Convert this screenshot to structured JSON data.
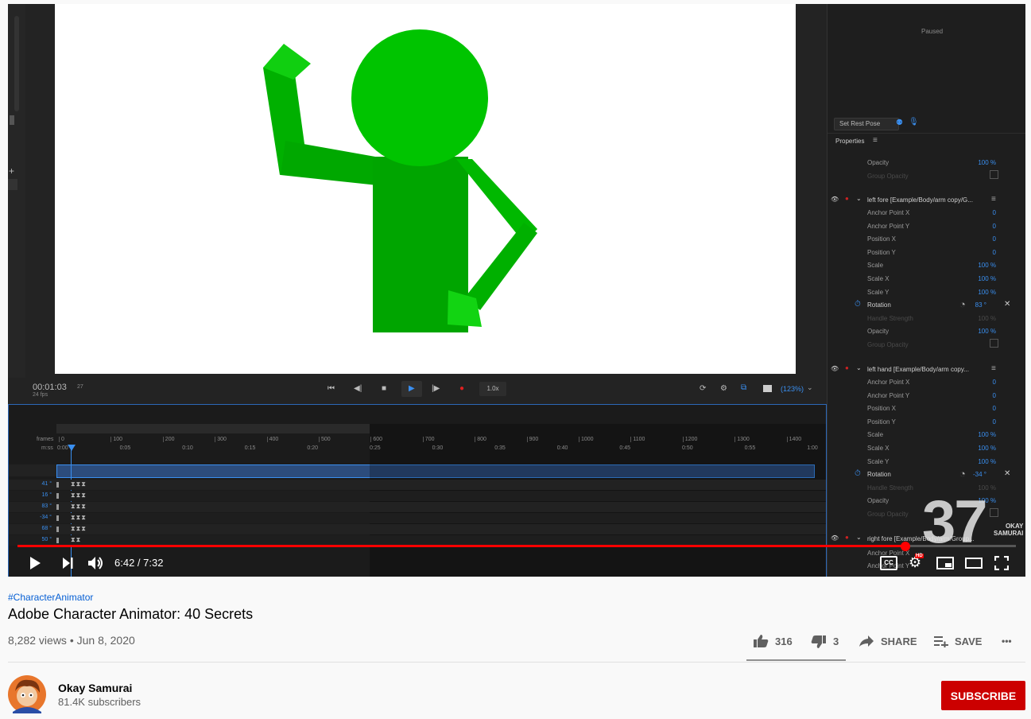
{
  "video": {
    "app_ui": {
      "status": "Paused",
      "set_rest_pose": "Set Rest Pose",
      "properties_title": "Properties",
      "timecode": "00:01:03",
      "frame": "27",
      "fps": "24 fps",
      "speed": "1.0x",
      "zoom": "(123%)",
      "props_top": [
        {
          "label": "Opacity",
          "value": "100 %"
        },
        {
          "label": "Group Opacity",
          "value": ""
        }
      ],
      "layer1": {
        "name": "left fore [Example/Body/arm copy/G...",
        "rows": [
          {
            "label": "Anchor Point X",
            "value": "0"
          },
          {
            "label": "Anchor Point Y",
            "value": "0"
          },
          {
            "label": "Position X",
            "value": "0"
          },
          {
            "label": "Position Y",
            "value": "0"
          },
          {
            "label": "Scale",
            "value": "100 %"
          },
          {
            "label": "Scale X",
            "value": "100 %"
          },
          {
            "label": "Scale Y",
            "value": "100 %"
          },
          {
            "label": "Rotation",
            "value": "83 °"
          },
          {
            "label": "Handle Strength",
            "value": "100 %"
          },
          {
            "label": "Opacity",
            "value": "100 %"
          },
          {
            "label": "Group Opacity",
            "value": ""
          }
        ]
      },
      "layer2": {
        "name": "left hand [Example/Body/arm copy...",
        "rows": [
          {
            "label": "Anchor Point X",
            "value": "0"
          },
          {
            "label": "Anchor Point Y",
            "value": "0"
          },
          {
            "label": "Position X",
            "value": "0"
          },
          {
            "label": "Position Y",
            "value": "0"
          },
          {
            "label": "Scale",
            "value": "100 %"
          },
          {
            "label": "Scale X",
            "value": "100 %"
          },
          {
            "label": "Scale Y",
            "value": "100 %"
          },
          {
            "label": "Rotation",
            "value": "-34 °"
          },
          {
            "label": "Handle Strength",
            "value": "100 %"
          },
          {
            "label": "Opacity",
            "value": "100 %"
          },
          {
            "label": "Group Opacity",
            "value": ""
          }
        ]
      },
      "layer3": {
        "name": "right fore [Example/Body/arm/Group...",
        "rows": [
          {
            "label": "Anchor Point X",
            "value": "0"
          },
          {
            "label": "Anchor Point Y",
            "value": ""
          }
        ]
      },
      "timeline": {
        "frames_label": "frames",
        "mss_label": "m:ss",
        "frame_ticks": [
          "0",
          "100",
          "200",
          "300",
          "400",
          "500",
          "600",
          "700",
          "800",
          "900",
          "1000",
          "1100",
          "1200",
          "1300",
          "1400"
        ],
        "time_ticks": [
          "0:00",
          "0:05",
          "0:10",
          "0:15",
          "0:20",
          "0:25",
          "0:30",
          "0:35",
          "0:40",
          "0:45",
          "0:50",
          "0:55",
          "1:00"
        ],
        "track_values": [
          "41 °",
          "16 °",
          "83 °",
          "-34 °",
          "68 °",
          "50 °"
        ]
      }
    },
    "overlay_number": "37",
    "overlay_brand": [
      "OKAY",
      "SAMURAI"
    ],
    "time_current": "6:42",
    "time_total": "7:32",
    "time_display": "6:42 / 7:32",
    "progress_fraction": 0.889,
    "hd_badge": "HD",
    "cc_label": "CC"
  },
  "meta": {
    "hashtag": "#CharacterAnimator",
    "title": "Adobe Character Animator: 40 Secrets",
    "views_date": "8,282 views • Jun 8, 2020",
    "likes": "316",
    "dislikes": "3",
    "share": "SHARE",
    "save": "SAVE",
    "more": "•••"
  },
  "channel": {
    "name": "Okay Samurai",
    "subscribers": "81.4K subscribers",
    "subscribe": "SUBSCRIBE"
  },
  "colors": {
    "progress": "#ff0000",
    "subscribe_bg": "#cc0000",
    "figure_green": "#00b300",
    "accent_blue": "#3a8ff0"
  }
}
